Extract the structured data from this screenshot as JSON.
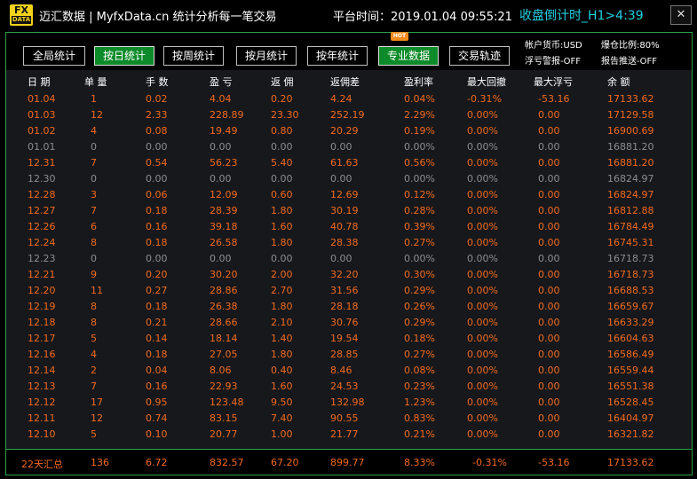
{
  "titlebar": {
    "logo_top": "FX",
    "logo_bottom": "DATA",
    "app_title": "迈汇数据 | MyfxData.cn  统计分析每一笔交易",
    "platform_time": "平台时间：2019.01.04 09:55:21",
    "countdown": "收盘倒计时_H1>4:39",
    "close_glyph": "✕"
  },
  "tabs": [
    {
      "label": "全局统计",
      "active": false
    },
    {
      "label": "按日统计",
      "active": true
    },
    {
      "label": "按周统计",
      "active": false
    },
    {
      "label": "按月统计",
      "active": false
    },
    {
      "label": "按年统计",
      "active": false
    },
    {
      "label": "专业数据",
      "active": true
    },
    {
      "label": "交易轨迹",
      "active": false
    }
  ],
  "hot_badge": "HOT",
  "info": {
    "currency": "帐户货币:USD",
    "margin": "爆仓比例:80%",
    "float_alert": "浮亏警报-OFF",
    "report_push": "报告推送-OFF"
  },
  "columns": [
    "日 期",
    "单 量",
    "手 数",
    "盈 亏",
    "返 佣",
    "返佣差",
    "盈利率",
    "最大回撤",
    "最大浮亏",
    "余 额"
  ],
  "rows": [
    [
      "01.04",
      "1",
      "0.02",
      "4.04",
      "0.20",
      "4.24",
      "0.04%",
      "-0.31%",
      "-53.16",
      "17133.62"
    ],
    [
      "01.03",
      "12",
      "2.33",
      "228.89",
      "23.30",
      "252.19",
      "2.29%",
      "0.00%",
      "0.00",
      "17129.58"
    ],
    [
      "01.02",
      "4",
      "0.08",
      "19.49",
      "0.80",
      "20.29",
      "0.19%",
      "0.00%",
      "0.00",
      "16900.69"
    ],
    [
      "01.01",
      "0",
      "0.00",
      "0.00",
      "0.00",
      "0.00",
      "0.00%",
      "0.00%",
      "0.00",
      "16881.20"
    ],
    [
      "12.31",
      "7",
      "0.54",
      "56.23",
      "5.40",
      "61.63",
      "0.56%",
      "0.00%",
      "0.00",
      "16881.20"
    ],
    [
      "12.30",
      "0",
      "0.00",
      "0.00",
      "0.00",
      "0.00",
      "0.00%",
      "0.00%",
      "0.00",
      "16824.97"
    ],
    [
      "12.28",
      "3",
      "0.06",
      "12.09",
      "0.60",
      "12.69",
      "0.12%",
      "0.00%",
      "0.00",
      "16824.97"
    ],
    [
      "12.27",
      "7",
      "0.18",
      "28.39",
      "1.80",
      "30.19",
      "0.28%",
      "0.00%",
      "0.00",
      "16812.88"
    ],
    [
      "12.26",
      "6",
      "0.16",
      "39.18",
      "1.60",
      "40.78",
      "0.39%",
      "0.00%",
      "0.00",
      "16784.49"
    ],
    [
      "12.24",
      "8",
      "0.18",
      "26.58",
      "1.80",
      "28.38",
      "0.27%",
      "0.00%",
      "0.00",
      "16745.31"
    ],
    [
      "12.23",
      "0",
      "0.00",
      "0.00",
      "0.00",
      "0.00",
      "0.00%",
      "0.00%",
      "0.00",
      "16718.73"
    ],
    [
      "12.21",
      "9",
      "0.20",
      "30.20",
      "2.00",
      "32.20",
      "0.30%",
      "0.00%",
      "0.00",
      "16718.73"
    ],
    [
      "12.20",
      "11",
      "0.27",
      "28.86",
      "2.70",
      "31.56",
      "0.29%",
      "0.00%",
      "0.00",
      "16688.53"
    ],
    [
      "12.19",
      "8",
      "0.18",
      "26.38",
      "1.80",
      "28.18",
      "0.26%",
      "0.00%",
      "0.00",
      "16659.67"
    ],
    [
      "12.18",
      "8",
      "0.21",
      "28.66",
      "2.10",
      "30.76",
      "0.29%",
      "0.00%",
      "0.00",
      "16633.29"
    ],
    [
      "12.17",
      "5",
      "0.14",
      "18.14",
      "1.40",
      "19.54",
      "0.18%",
      "0.00%",
      "0.00",
      "16604.63"
    ],
    [
      "12.16",
      "4",
      "0.18",
      "27.05",
      "1.80",
      "28.85",
      "0.27%",
      "0.00%",
      "0.00",
      "16586.49"
    ],
    [
      "12.14",
      "2",
      "0.04",
      "8.06",
      "0.40",
      "8.46",
      "0.08%",
      "0.00%",
      "0.00",
      "16559.44"
    ],
    [
      "12.13",
      "7",
      "0.16",
      "22.93",
      "1.60",
      "24.53",
      "0.23%",
      "0.00%",
      "0.00",
      "16551.38"
    ],
    [
      "12.12",
      "17",
      "0.95",
      "123.48",
      "9.50",
      "132.98",
      "1.23%",
      "0.00%",
      "0.00",
      "16528.45"
    ],
    [
      "12.11",
      "12",
      "0.74",
      "83.15",
      "7.40",
      "90.55",
      "0.83%",
      "0.00%",
      "0.00",
      "16404.97"
    ],
    [
      "12.10",
      "5",
      "0.10",
      "20.77",
      "1.00",
      "21.77",
      "0.21%",
      "0.00%",
      "0.00",
      "16321.82"
    ]
  ],
  "summary": [
    "22天汇总",
    "136",
    "6.72",
    "832.57",
    "67.20",
    "899.77",
    "8.33%",
    "-0.31%",
    "-53.16",
    "17133.62"
  ],
  "colors": {
    "positive_text": "#f26a1e",
    "zero_text": "#8d8d8d",
    "accent_green": "#0d8b2a",
    "countdown_cyan": "#1fd0e0",
    "logo_yellow": "#f2d21b"
  }
}
